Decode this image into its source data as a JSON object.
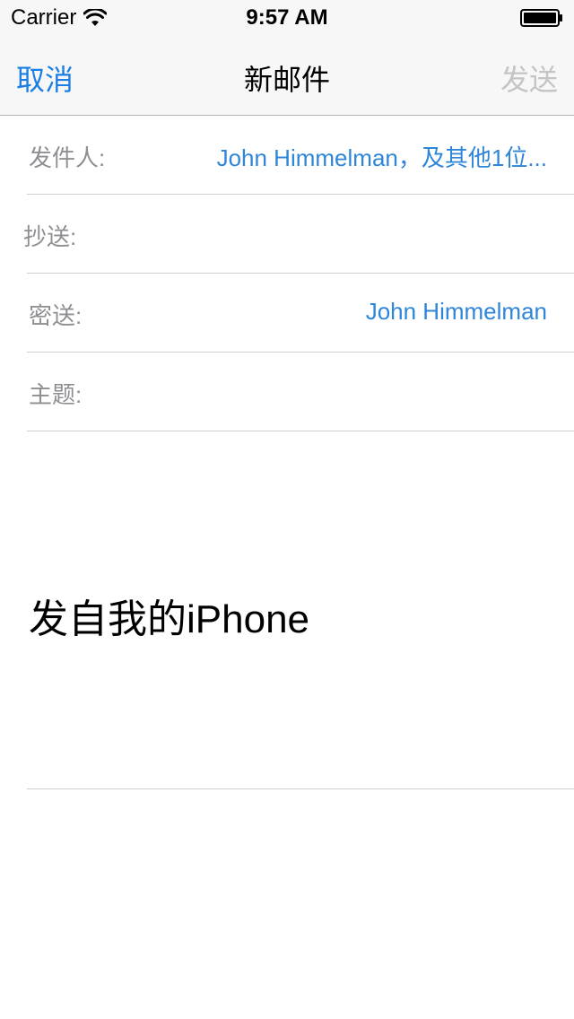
{
  "status_bar": {
    "carrier": "Carrier",
    "time": "9:57 AM",
    "icons": [
      "wifi-icon",
      "battery-icon"
    ]
  },
  "nav": {
    "cancel_label": "取消",
    "title": "新邮件",
    "send_label": "发送",
    "send_enabled": false
  },
  "fields": {
    "from": {
      "label": "发件人:",
      "value": "John Himmelman，及其他1位..."
    },
    "cc": {
      "label": "抄送:",
      "value": ""
    },
    "bcc": {
      "label": "密送:",
      "value": "John Himmelman"
    },
    "subject": {
      "label": "主题:",
      "value": ""
    }
  },
  "body": {
    "signature": "发自我的iPhone"
  },
  "colors": {
    "accent": "#1a7ee2",
    "link_value": "#2f86d8",
    "label_gray": "#8e8e93",
    "disabled": "#c4c4c4",
    "bar_background": "#f7f7f7"
  }
}
